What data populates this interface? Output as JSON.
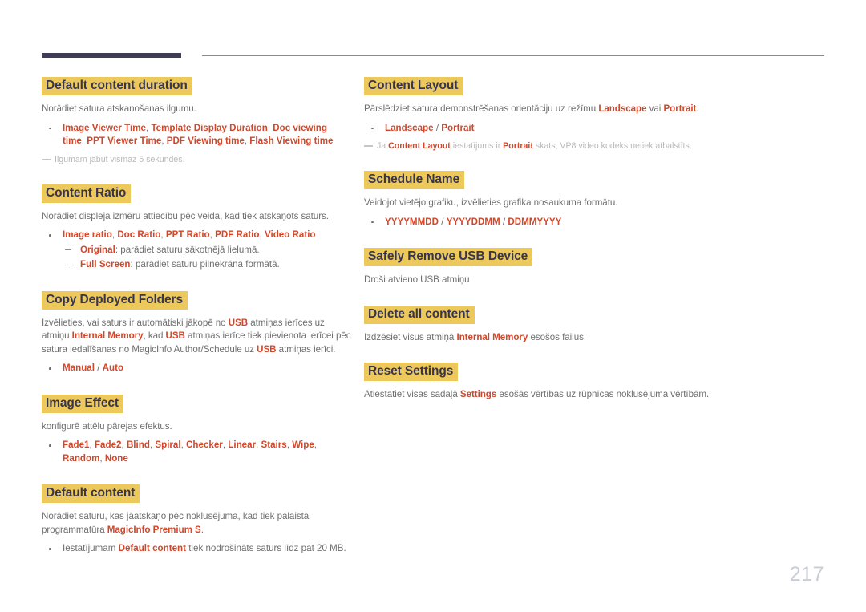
{
  "page": {
    "number": "217",
    "accent_color": "#d2472a",
    "highlight_color": "#edc95c",
    "heading_text_color": "#38364f",
    "body_text_color": "#6f6f6f",
    "note_text_color": "#b9b9b9",
    "rule_thick_color": "#3e3c56",
    "rule_thin_color": "#8a8a8a"
  },
  "left_column": {
    "sections": [
      {
        "title": "Default content duration",
        "body_html": "Norādiet satura atskaņošanas ilgumu.",
        "bullets": [
          {
            "html": "<span class=\"accent\">Image Viewer Time</span>, <span class=\"accent\">Template Display Duration</span>, <span class=\"accent\">Doc viewing time</span>, <span class=\"accent\">PPT Viewer Time</span>, <span class=\"accent\">PDF Viewing time</span>, <span class=\"accent\">Flash Viewing time</span>"
          }
        ],
        "note_html": "Ilgumam jābūt vismaz 5 sekundes."
      },
      {
        "title": "Content Ratio",
        "body_html": "Norādiet displeja izmēru attiecību pēc veida, kad tiek atskaņots saturs.",
        "bullets": [
          {
            "html": "<span class=\"accent\">Image ratio</span>, <span class=\"accent\">Doc Ratio</span>, <span class=\"accent\">PPT Ratio</span>, <span class=\"accent\">PDF Ratio</span>, <span class=\"accent\">Video Ratio</span>",
            "sub": [
              "<span class=\"accent\">Original</span>: parādiet saturu sākotnējā lielumā.",
              "<span class=\"accent\">Full Screen</span>: parādiet saturu pilnekrāna formātā."
            ]
          }
        ]
      },
      {
        "title": "Copy Deployed Folders",
        "body_html": "Izvēlieties, vai saturs ir automātiski jākopē no <span class=\"accent\">USB</span> atmiņas ierīces uz atmiņu <span class=\"accent\">Internal Memory</span>, kad <span class=\"accent\">USB</span> atmiņas ierīce tiek pievienota ierīcei pēc satura iedalīšanas no MagicInfo Author/Schedule uz <span class=\"accent\">USB</span> atmiņas ierīci.",
        "bullets": [
          {
            "html": "<span class=\"accent\">Manual</span> <span style=\"color:#6f6f6f\">/</span> <span class=\"accent\">Auto</span>"
          }
        ]
      },
      {
        "title": "Image Effect",
        "body_html": "konfigurē attēlu pārejas efektus.",
        "bullets": [
          {
            "html": "<span class=\"accent\">Fade1</span>, <span class=\"accent\">Fade2</span>, <span class=\"accent\">Blind</span>, <span class=\"accent\">Spiral</span>, <span class=\"accent\">Checker</span>, <span class=\"accent\">Linear</span>, <span class=\"accent\">Stairs</span>, <span class=\"accent\">Wipe</span>, <span class=\"accent\">Random</span>, <span class=\"accent\">None</span>"
          }
        ]
      },
      {
        "title": "Default content",
        "body_html": "Norādiet saturu, kas jāatskaņo pēc noklusējuma, kad tiek palaista programmatūra <span class=\"accent\">MagicInfo Premium S</span>.",
        "bullets": [
          {
            "html": "Iestatījumam <span class=\"accent\">Default content</span> tiek nodrošināts saturs līdz pat 20 MB."
          }
        ]
      }
    ]
  },
  "right_column": {
    "sections": [
      {
        "title": "Content Layout",
        "body_html": "Pārslēdziet satura demonstrēšanas orientāciju uz režīmu <span class=\"accent\">Landscape</span> vai <span class=\"accent\">Portrait</span>.",
        "bullets": [
          {
            "html": "<span class=\"accent\">Landscape</span> <span style=\"color:#6f6f6f\">/</span> <span class=\"accent\">Portrait</span>"
          }
        ],
        "note_html": "Ja <span class=\"accent\">Content Layout</span> iestatījums ir <span class=\"accent\">Portrait</span> skats, VP8 video kodeks netiek atbalstīts."
      },
      {
        "title": "Schedule Name",
        "body_html": "Veidojot vietējo grafiku, izvēlieties grafika nosaukuma formātu.",
        "bullets": [
          {
            "html": "<span class=\"accent\">YYYYMMDD</span> <span style=\"color:#6f6f6f\">/</span> <span class=\"accent\">YYYYDDMM</span> <span style=\"color:#6f6f6f\">/</span> <span class=\"accent\">DDMMYYYY</span>"
          }
        ]
      },
      {
        "title": "Safely Remove USB Device",
        "body_html": "Droši atvieno USB atmiņu"
      },
      {
        "title": "Delete all content",
        "body_html": "Izdzēsiet visus atmiņā <span class=\"accent\">Internal Memory</span> esošos failus."
      },
      {
        "title": "Reset Settings",
        "body_html": "Atiestatiet visas sadaļā <span class=\"accent\">Settings</span> esošās vērtības uz rūpnīcas noklusējuma vērtībām."
      }
    ]
  }
}
